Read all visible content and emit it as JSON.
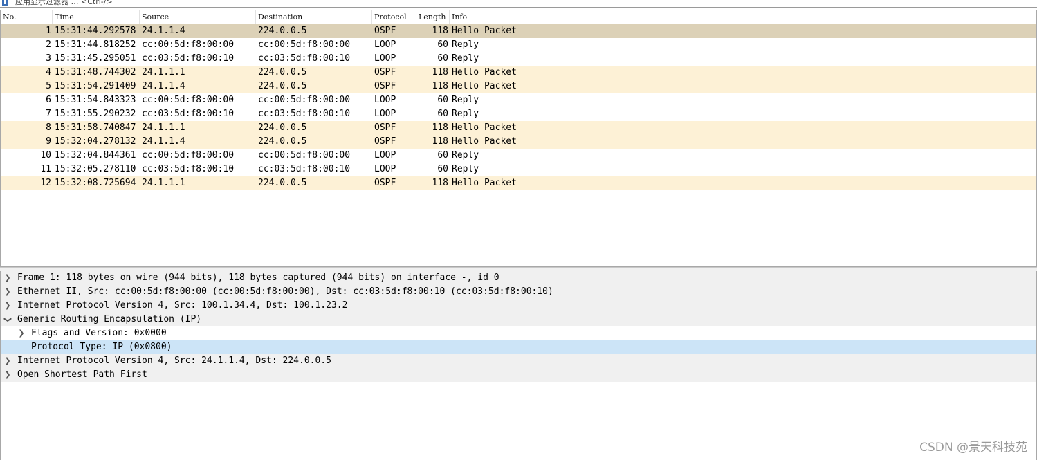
{
  "filter_bar": {
    "placeholder": "应用显示过滤器 … <Ctrl-/>"
  },
  "packet_list": {
    "columns": [
      "No.",
      "Time",
      "Source",
      "Destination",
      "Protocol",
      "Length",
      "Info"
    ],
    "rows": [
      {
        "no": "1",
        "time": "15:31:44.292578",
        "src": "24.1.1.4",
        "dst": "224.0.0.5",
        "proto": "OSPF",
        "len": "118",
        "info": "Hello Packet"
      },
      {
        "no": "2",
        "time": "15:31:44.818252",
        "src": "cc:00:5d:f8:00:00",
        "dst": "cc:00:5d:f8:00:00",
        "proto": "LOOP",
        "len": "60",
        "info": "Reply"
      },
      {
        "no": "3",
        "time": "15:31:45.295051",
        "src": "cc:03:5d:f8:00:10",
        "dst": "cc:03:5d:f8:00:10",
        "proto": "LOOP",
        "len": "60",
        "info": "Reply"
      },
      {
        "no": "4",
        "time": "15:31:48.744302",
        "src": "24.1.1.1",
        "dst": "224.0.0.5",
        "proto": "OSPF",
        "len": "118",
        "info": "Hello Packet"
      },
      {
        "no": "5",
        "time": "15:31:54.291409",
        "src": "24.1.1.4",
        "dst": "224.0.0.5",
        "proto": "OSPF",
        "len": "118",
        "info": "Hello Packet"
      },
      {
        "no": "6",
        "time": "15:31:54.843323",
        "src": "cc:00:5d:f8:00:00",
        "dst": "cc:00:5d:f8:00:00",
        "proto": "LOOP",
        "len": "60",
        "info": "Reply"
      },
      {
        "no": "7",
        "time": "15:31:55.290232",
        "src": "cc:03:5d:f8:00:10",
        "dst": "cc:03:5d:f8:00:10",
        "proto": "LOOP",
        "len": "60",
        "info": "Reply"
      },
      {
        "no": "8",
        "time": "15:31:58.740847",
        "src": "24.1.1.1",
        "dst": "224.0.0.5",
        "proto": "OSPF",
        "len": "118",
        "info": "Hello Packet"
      },
      {
        "no": "9",
        "time": "15:32:04.278132",
        "src": "24.1.1.4",
        "dst": "224.0.0.5",
        "proto": "OSPF",
        "len": "118",
        "info": "Hello Packet"
      },
      {
        "no": "10",
        "time": "15:32:04.844361",
        "src": "cc:00:5d:f8:00:00",
        "dst": "cc:00:5d:f8:00:00",
        "proto": "LOOP",
        "len": "60",
        "info": "Reply"
      },
      {
        "no": "11",
        "time": "15:32:05.278110",
        "src": "cc:03:5d:f8:00:10",
        "dst": "cc:03:5d:f8:00:10",
        "proto": "LOOP",
        "len": "60",
        "info": "Reply"
      },
      {
        "no": "12",
        "time": "15:32:08.725694",
        "src": "24.1.1.1",
        "dst": "224.0.0.5",
        "proto": "OSPF",
        "len": "118",
        "info": "Hello Packet"
      }
    ]
  },
  "details": {
    "items": [
      {
        "text": "Frame 1: 118 bytes on wire (944 bits), 118 bytes captured (944 bits) on interface -, id 0",
        "expanded": false
      },
      {
        "text": "Ethernet II, Src: cc:00:5d:f8:00:00 (cc:00:5d:f8:00:00), Dst: cc:03:5d:f8:00:10 (cc:03:5d:f8:00:10)",
        "expanded": false
      },
      {
        "text": "Internet Protocol Version 4, Src: 100.1.34.4, Dst: 100.1.23.2",
        "expanded": false
      },
      {
        "text": "Generic Routing Encapsulation (IP)",
        "expanded": true
      },
      {
        "text": "Flags and Version: 0x0000",
        "expanded": false
      },
      {
        "text": "Protocol Type: IP (0x0800)"
      },
      {
        "text": "Internet Protocol Version 4, Src: 24.1.1.4, Dst: 224.0.0.5",
        "expanded": false
      },
      {
        "text": "Open Shortest Path First",
        "expanded": false
      }
    ],
    "icons": {
      "collapsed": "chevron-right-icon",
      "expanded": "chevron-down-icon"
    }
  },
  "colors": {
    "ospf_row": "#fdf1d6",
    "loop_row": "#ffffff",
    "selected_row": "#dcd1b7",
    "detail_highlight": "#cce4f7"
  },
  "watermark": "CSDN @景天科技苑"
}
